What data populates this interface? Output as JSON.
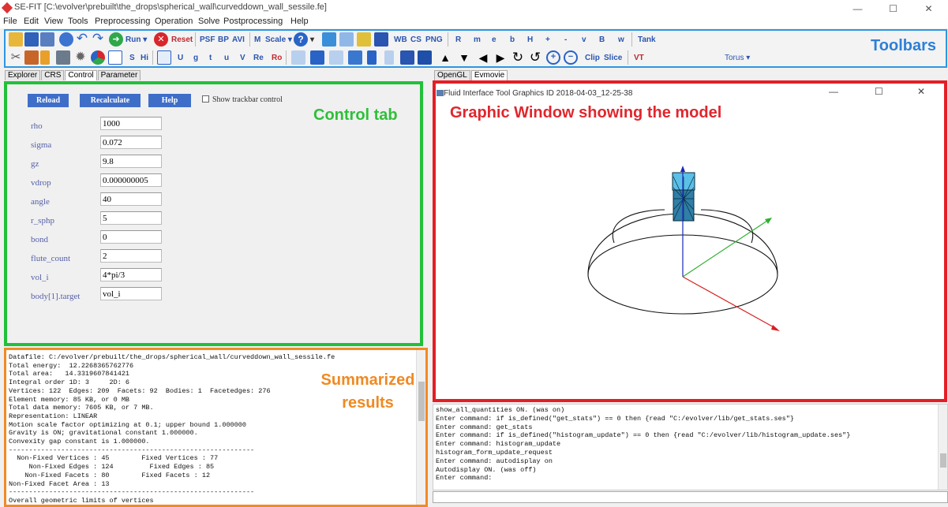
{
  "window": {
    "title": "SE-FIT [C:\\evolver\\prebuilt\\the_drops\\spherical_wall\\curveddown_wall_sessile.fe]",
    "minimize": "—",
    "maximize": "☐",
    "close": "✕"
  },
  "menu": [
    "File",
    "Edit",
    "View",
    "Tools",
    "Preprocessing",
    "Operation",
    "Solve",
    "Postprocessing",
    "Help"
  ],
  "toolbar_row1": {
    "run": "Run ▾",
    "reset": "Reset",
    "psf": "PSF",
    "bp": "BP",
    "avi": "AVI",
    "m": "M",
    "scale": "Scale ▾",
    "wb": "WB",
    "cs": "CS",
    "png": "PNG",
    "letters": [
      "R",
      "m",
      "e",
      "b",
      "H",
      "+",
      "-",
      "v",
      "B",
      "w"
    ],
    "tank": "Tank"
  },
  "toolbar_row2": {
    "s": "S",
    "hi": "Hi",
    "letters": [
      "U",
      "g",
      "t",
      "u",
      "V",
      "Re"
    ],
    "ro": "Ro",
    "clip": "Clip",
    "slice": "Slice",
    "vt": "VT",
    "torus": "Torus ▾"
  },
  "annotations": {
    "toolbars": "Toolbars",
    "control_tab": "Control tab",
    "graphic_window": "Graphic Window showing the model",
    "summary_line1": "Summarized",
    "summary_line2": "results"
  },
  "left_tabs": [
    "Explorer",
    "CRS",
    "Control",
    "Parameter"
  ],
  "right_tabs": [
    "OpenGL",
    "Evmovie"
  ],
  "control": {
    "buttons": {
      "reload": "Reload",
      "recalculate": "Recalculate",
      "help": "Help"
    },
    "show_trackbar": "Show trackbar control",
    "params": [
      {
        "label": "rho",
        "value": "1000"
      },
      {
        "label": "sigma",
        "value": "0.072"
      },
      {
        "label": "gz",
        "value": "9.8"
      },
      {
        "label": "vdrop",
        "value": "0.000000005"
      },
      {
        "label": "angle",
        "value": "40"
      },
      {
        "label": "r_sphp",
        "value": "5"
      },
      {
        "label": "bond",
        "value": "0"
      },
      {
        "label": "flute_count",
        "value": "2"
      },
      {
        "label": "vol_i",
        "value": "4*pi/3"
      },
      {
        "label": "body[1].target",
        "value": "vol_i"
      }
    ]
  },
  "summary_text": "Datafile: C:/evolver/prebuilt/the_drops/spherical_wall/curveddown_wall_sessile.fe\nTotal energy:  12.2268365762776\nTotal area:   14.3319607841421\nIntegral order 1D: 3     2D: 6\nVertices: 122  Edges: 209  Facets: 92  Bodies: 1  Facetedges: 276\nElement memory: 85 KB, or 0 MB\nTotal data memory: 7605 KB, or 7 MB.\nRepresentation: LINEAR\nMotion scale factor optimizing at 0.1; upper bound 1.000000\nGravity is ON; gravitational constant 1.000000.\nConvexity gap constant is 1.000000.\n-------------------------------------------------------------\n  Non-Fixed Vertices : 45        Fixed Vertices : 77\n     Non-Fixed Edges : 124         Fixed Edges : 85\n    Non-Fixed Facets : 80        Fixed Facets : 12\nNon-Fixed Facet Area : 13\n-------------------------------------------------------------\nOverall geometric limits of vertices",
  "graphics_window": {
    "title": "Fluid Interface Tool Graphics ID 2018-04-03_12-25-38"
  },
  "console_text": "show_all_quantities ON. (was on)\nEnter command: if is_defined(\"get_stats\") == 0 then {read \"C:/evolver/lib/get_stats.ses\"}\nEnter command: get_stats\nEnter command: if is_defined(\"histogram_update\") == 0 then {read \"C:/evolver/lib/histogram_update.ses\"}\nEnter command: histogram_update\nhistogram_form_update_request\nEnter command: autodisplay on\nAutodisplay ON. (was off)\nEnter command:",
  "icons": [
    "open-icon",
    "save-icon",
    "refresh-icon",
    "undo-icon",
    "redo-icon",
    "run-icon",
    "reset-icon",
    "help-icon",
    "zoom-in-icon",
    "zoom-out-icon"
  ]
}
